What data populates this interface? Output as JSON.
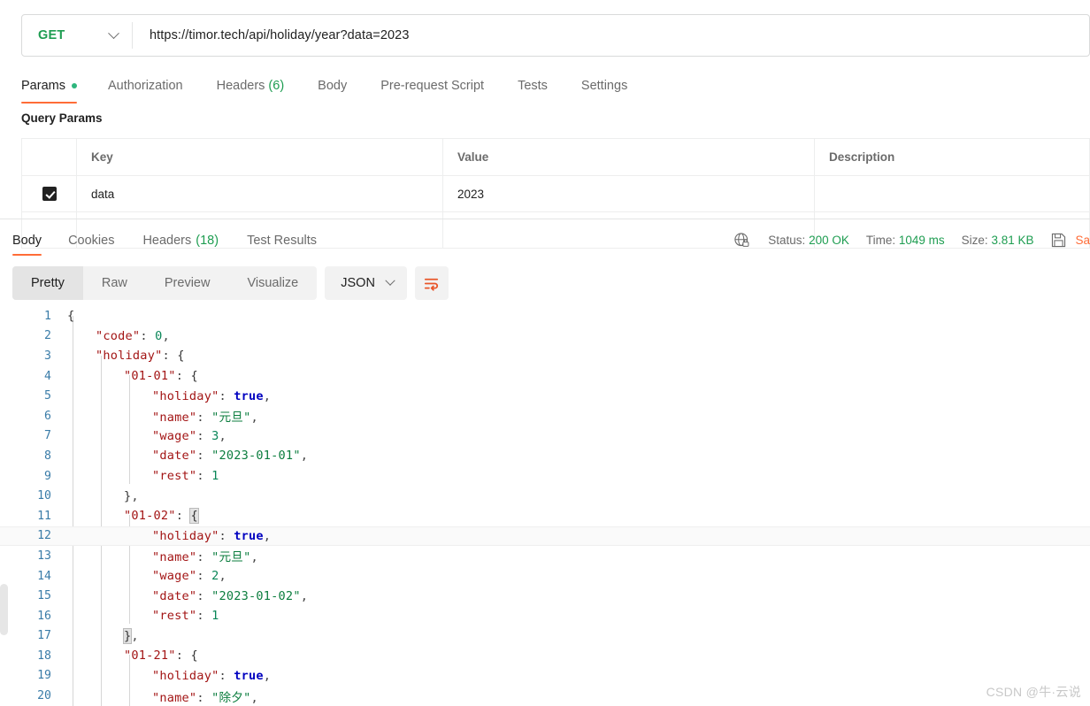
{
  "request": {
    "method": "GET",
    "method_color": "#1e9d51",
    "url": "https://timor.tech/api/holiday/year?data=2023",
    "tabs": [
      {
        "label": "Params",
        "has_dot": true,
        "active": true
      },
      {
        "label": "Authorization",
        "has_dot": false,
        "active": false
      },
      {
        "label": "Headers",
        "count": "(6)",
        "has_dot": false,
        "active": false
      },
      {
        "label": "Body",
        "has_dot": false,
        "active": false
      },
      {
        "label": "Pre-request Script",
        "has_dot": false,
        "active": false
      },
      {
        "label": "Tests",
        "has_dot": false,
        "active": false
      },
      {
        "label": "Settings",
        "has_dot": false,
        "active": false
      }
    ]
  },
  "query_params": {
    "section_title": "Query Params",
    "columns": [
      "Key",
      "Value",
      "Description"
    ],
    "rows": [
      {
        "checked": true,
        "key": "data",
        "value": "2023",
        "description": ""
      }
    ]
  },
  "response": {
    "tabs": [
      {
        "label": "Body",
        "active": true
      },
      {
        "label": "Cookies",
        "active": false
      },
      {
        "label": "Headers",
        "count": "(18)",
        "active": false
      },
      {
        "label": "Test Results",
        "active": false
      }
    ],
    "status": {
      "label": "Status:",
      "value": "200 OK"
    },
    "time": {
      "label": "Time:",
      "value": "1049 ms"
    },
    "size": {
      "label": "Size:",
      "value": "3.81 KB"
    },
    "save_label": "Sa",
    "accent_color": "#ff6c37",
    "success_color": "#1e9d51",
    "view_modes": [
      {
        "label": "Pretty",
        "active": true
      },
      {
        "label": "Raw",
        "active": false
      },
      {
        "label": "Preview",
        "active": false
      },
      {
        "label": "Visualize",
        "active": false
      }
    ],
    "format": "JSON"
  },
  "code": {
    "lines": [
      {
        "num": "1",
        "indent": 0,
        "highlight": false,
        "tokens": [
          {
            "t": "{",
            "c": "br"
          }
        ]
      },
      {
        "num": "2",
        "indent": 1,
        "highlight": false,
        "tokens": [
          {
            "t": "\"code\"",
            "c": "k"
          },
          {
            "t": ": ",
            "c": "p"
          },
          {
            "t": "0",
            "c": "n"
          },
          {
            "t": ",",
            "c": "p"
          }
        ]
      },
      {
        "num": "3",
        "indent": 1,
        "highlight": false,
        "tokens": [
          {
            "t": "\"holiday\"",
            "c": "k"
          },
          {
            "t": ": ",
            "c": "p"
          },
          {
            "t": "{",
            "c": "br"
          }
        ]
      },
      {
        "num": "4",
        "indent": 2,
        "highlight": false,
        "tokens": [
          {
            "t": "\"01-01\"",
            "c": "k"
          },
          {
            "t": ": ",
            "c": "p"
          },
          {
            "t": "{",
            "c": "br"
          }
        ]
      },
      {
        "num": "5",
        "indent": 3,
        "highlight": false,
        "tokens": [
          {
            "t": "\"holiday\"",
            "c": "k"
          },
          {
            "t": ": ",
            "c": "p"
          },
          {
            "t": "true",
            "c": "b"
          },
          {
            "t": ",",
            "c": "p"
          }
        ]
      },
      {
        "num": "6",
        "indent": 3,
        "highlight": false,
        "tokens": [
          {
            "t": "\"name\"",
            "c": "k"
          },
          {
            "t": ": ",
            "c": "p"
          },
          {
            "t": "\"元旦\"",
            "c": "s"
          },
          {
            "t": ",",
            "c": "p"
          }
        ]
      },
      {
        "num": "7",
        "indent": 3,
        "highlight": false,
        "tokens": [
          {
            "t": "\"wage\"",
            "c": "k"
          },
          {
            "t": ": ",
            "c": "p"
          },
          {
            "t": "3",
            "c": "n"
          },
          {
            "t": ",",
            "c": "p"
          }
        ]
      },
      {
        "num": "8",
        "indent": 3,
        "highlight": false,
        "tokens": [
          {
            "t": "\"date\"",
            "c": "k"
          },
          {
            "t": ": ",
            "c": "p"
          },
          {
            "t": "\"2023-01-01\"",
            "c": "s"
          },
          {
            "t": ",",
            "c": "p"
          }
        ]
      },
      {
        "num": "9",
        "indent": 3,
        "highlight": false,
        "tokens": [
          {
            "t": "\"rest\"",
            "c": "k"
          },
          {
            "t": ": ",
            "c": "p"
          },
          {
            "t": "1",
            "c": "n"
          }
        ]
      },
      {
        "num": "10",
        "indent": 2,
        "highlight": false,
        "tokens": [
          {
            "t": "}",
            "c": "br"
          },
          {
            "t": ",",
            "c": "p"
          }
        ]
      },
      {
        "num": "11",
        "indent": 2,
        "highlight": false,
        "tokens": [
          {
            "t": "\"01-02\"",
            "c": "k"
          },
          {
            "t": ": ",
            "c": "p"
          },
          {
            "t": "{",
            "c": "brm"
          }
        ]
      },
      {
        "num": "12",
        "indent": 3,
        "highlight": true,
        "tokens": [
          {
            "t": "\"holiday\"",
            "c": "k"
          },
          {
            "t": ": ",
            "c": "p"
          },
          {
            "t": "true",
            "c": "b"
          },
          {
            "t": ",",
            "c": "p"
          }
        ]
      },
      {
        "num": "13",
        "indent": 3,
        "highlight": false,
        "tokens": [
          {
            "t": "\"name\"",
            "c": "k"
          },
          {
            "t": ": ",
            "c": "p"
          },
          {
            "t": "\"元旦\"",
            "c": "s"
          },
          {
            "t": ",",
            "c": "p"
          }
        ]
      },
      {
        "num": "14",
        "indent": 3,
        "highlight": false,
        "tokens": [
          {
            "t": "\"wage\"",
            "c": "k"
          },
          {
            "t": ": ",
            "c": "p"
          },
          {
            "t": "2",
            "c": "n"
          },
          {
            "t": ",",
            "c": "p"
          }
        ]
      },
      {
        "num": "15",
        "indent": 3,
        "highlight": false,
        "tokens": [
          {
            "t": "\"date\"",
            "c": "k"
          },
          {
            "t": ": ",
            "c": "p"
          },
          {
            "t": "\"2023-01-02\"",
            "c": "s"
          },
          {
            "t": ",",
            "c": "p"
          }
        ]
      },
      {
        "num": "16",
        "indent": 3,
        "highlight": false,
        "tokens": [
          {
            "t": "\"rest\"",
            "c": "k"
          },
          {
            "t": ": ",
            "c": "p"
          },
          {
            "t": "1",
            "c": "n"
          }
        ]
      },
      {
        "num": "17",
        "indent": 2,
        "highlight": false,
        "tokens": [
          {
            "t": "}",
            "c": "brm"
          },
          {
            "t": ",",
            "c": "p"
          }
        ]
      },
      {
        "num": "18",
        "indent": 2,
        "highlight": false,
        "tokens": [
          {
            "t": "\"01-21\"",
            "c": "k"
          },
          {
            "t": ": ",
            "c": "p"
          },
          {
            "t": "{",
            "c": "br"
          }
        ]
      },
      {
        "num": "19",
        "indent": 3,
        "highlight": false,
        "tokens": [
          {
            "t": "\"holiday\"",
            "c": "k"
          },
          {
            "t": ": ",
            "c": "p"
          },
          {
            "t": "true",
            "c": "b"
          },
          {
            "t": ",",
            "c": "p"
          }
        ]
      },
      {
        "num": "20",
        "indent": 3,
        "highlight": false,
        "tokens": [
          {
            "t": "\"name\"",
            "c": "k"
          },
          {
            "t": ": ",
            "c": "p"
          },
          {
            "t": "\"除夕\"",
            "c": "s"
          },
          {
            "t": ",",
            "c": "p"
          }
        ]
      }
    ]
  },
  "watermark": "CSDN @牛·云说"
}
